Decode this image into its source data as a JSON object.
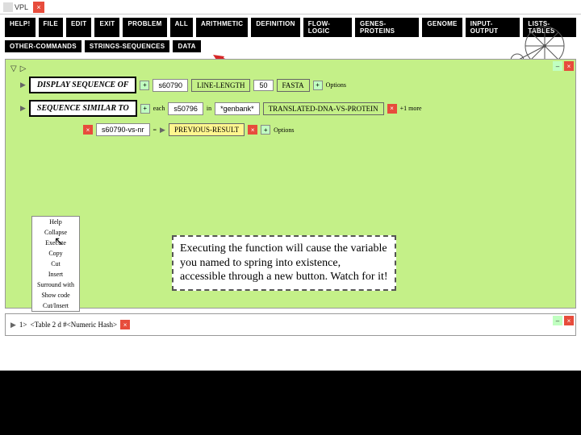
{
  "titlebar": {
    "title": "VPL"
  },
  "toolbar": {
    "row1": [
      "HELP!",
      "FILE",
      "EDIT",
      "EXIT",
      "PROBLEM",
      "ALL",
      "ARITHMETIC",
      "DEFINITION",
      "FLOW-LOGIC",
      "GENES-PROTEINS",
      "GENOME",
      "INPUT-OUTPUT",
      "LISTS-TABLES"
    ],
    "row2": [
      "OTHER-COMMANDS",
      "STRINGS-SEQUENCES",
      "DATA"
    ]
  },
  "ws": {
    "seq1": {
      "label": "DISPLAY SEQUENCE OF",
      "val": "s60790",
      "tag1": "LINE-LENGTH",
      "tag2": "FASTA",
      "num": "50",
      "opts": "Options"
    },
    "seq2": {
      "label": "SEQUENCE SIMILAR TO",
      "each": "each",
      "val": "s50796",
      "in": "in",
      "db": "*genbank*",
      "tag": "TRANSLATED-DNA-VS-PROTEIN",
      "tail": "+1 more"
    },
    "seq3": {
      "val": "s60790-vs-nr",
      "eq": "=",
      "tag": "PREVIOUS-RESULT",
      "opts": "Options"
    }
  },
  "menu": {
    "items": [
      "Help",
      "Collapse",
      "Execute",
      "Copy",
      "Cut",
      "Insert",
      "Surround with",
      "Show code",
      "Cut/Insert"
    ]
  },
  "callout": "Executing the function will cause the variable you named to spring into existence, accessible through a new button. Watch for it!",
  "result": {
    "idx": "1>",
    "text": "<Table 2 d #<Numeric Hash>"
  }
}
